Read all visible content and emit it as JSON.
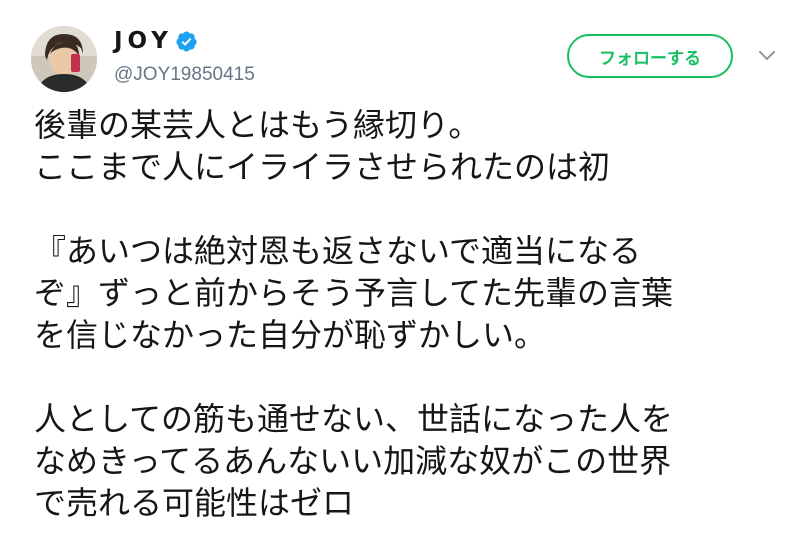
{
  "user": {
    "display_name": "JOY",
    "handle": "@JOY19850415",
    "verified": true,
    "avatar_icon": "profile-photo"
  },
  "actions": {
    "follow_label": "フォローする",
    "more_icon": "chevron-down-icon"
  },
  "colors": {
    "follow_green": "#17bf63",
    "verified_blue": "#1da1f2",
    "handle_gray": "#657786",
    "text": "#14171a"
  },
  "tweet": {
    "lines": [
      "後輩の某芸人とはもう縁切り。",
      "ここまで人にイライラさせられたのは初",
      "",
      "『あいつは絶対恩も返さないで適当になる",
      "ぞ』ずっと前からそう予言してた先輩の言葉",
      "を信じなかった自分が恥ずかしい。",
      "",
      "人としての筋も通せない、世話になった人を",
      "なめきってるあんないい加減な奴がこの世界",
      "で売れる可能性はゼロ"
    ]
  }
}
